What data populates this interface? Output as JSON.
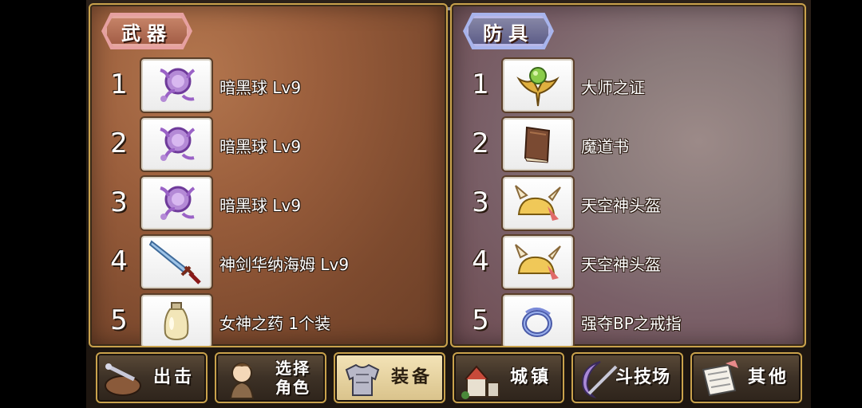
{
  "weapons_panel": {
    "title": "武器",
    "items": [
      {
        "rank": "1",
        "name": "暗黑球 Lv9",
        "icon": "dark-orb-icon"
      },
      {
        "rank": "2",
        "name": "暗黑球 Lv9",
        "icon": "dark-orb-icon"
      },
      {
        "rank": "3",
        "name": "暗黑球 Lv9",
        "icon": "dark-orb-icon"
      },
      {
        "rank": "4",
        "name": "神剑华纳海姆 Lv9",
        "icon": "sword-icon"
      },
      {
        "rank": "5",
        "name": "女神之药 1个装",
        "icon": "potion-icon"
      }
    ]
  },
  "armor_panel": {
    "title": "防具",
    "items": [
      {
        "rank": "1",
        "name": "大师之证",
        "icon": "master-emblem-icon"
      },
      {
        "rank": "2",
        "name": "魔道书",
        "icon": "spellbook-icon"
      },
      {
        "rank": "3",
        "name": "天空神头盔",
        "icon": "winged-helmet-icon"
      },
      {
        "rank": "4",
        "name": "天空神头盔",
        "icon": "winged-helmet-icon"
      },
      {
        "rank": "5",
        "name": "强夺BP之戒指",
        "icon": "ring-icon"
      }
    ]
  },
  "nav": {
    "sortie": "出击",
    "select_char_1": "选择",
    "select_char_2": "角色",
    "equip": "装备",
    "town": "城镇",
    "arena": "斗技场",
    "other": "其他"
  },
  "colors": {
    "frame_gold": "#c9a24c",
    "weapon_tag": "#a05a44",
    "armor_tag": "#5a5a86"
  }
}
